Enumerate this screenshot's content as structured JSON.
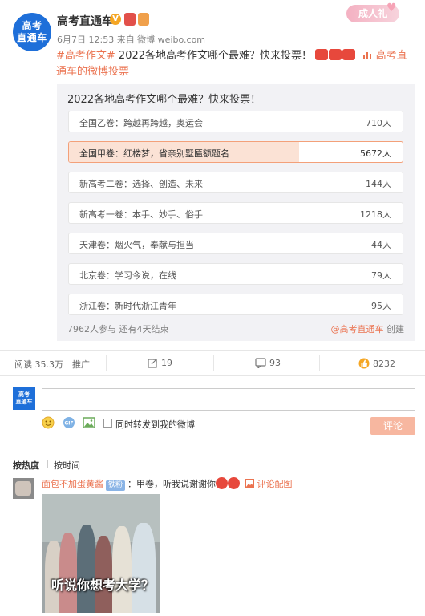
{
  "post": {
    "avatar_text": [
      "高考",
      "直通车"
    ],
    "username": "高考直通车",
    "verified_mark": "V",
    "gift_tag": "成人礼",
    "meta": "6月7日 12:53 来自 微博 weibo.com",
    "hashtag": "#高考作文#",
    "body_text": " 2022各地高考作文哪个最难？快来投票！",
    "source_link": "高考直通车的微博投票"
  },
  "vote": {
    "title": "2022各地高考作文哪个最难？快来投票！",
    "options": [
      {
        "label": "全国乙卷：跨越再跨越，奥运会",
        "count": "710人",
        "share": 0.0
      },
      {
        "label": "全国甲卷：红楼梦，省亲别墅匾额题名",
        "count": "5672人",
        "share": 0.69,
        "selected": true
      },
      {
        "label": "新高考二卷：选择、创造、未来",
        "count": "144人",
        "share": 0.0
      },
      {
        "label": "新高考一卷：本手、妙手、俗手",
        "count": "1218人",
        "share": 0.0
      },
      {
        "label": "天津卷：烟火气，奉献与担当",
        "count": "44人",
        "share": 0.0
      },
      {
        "label": "北京卷：学习今说，在线",
        "count": "79人",
        "share": 0.0
      },
      {
        "label": "浙江卷：新时代浙江青年",
        "count": "95人",
        "share": 0.0
      }
    ],
    "footer_left": "7962人参与 还有4天结束",
    "creator": "@高考直通车",
    "creator_suffix": " 创建"
  },
  "actions": {
    "reads": "阅读 35.3万",
    "promote": "推广",
    "reposts": "19",
    "comments": "93",
    "likes": "8232"
  },
  "comment_input": {
    "avatar_text": [
      "高考",
      "直通车"
    ],
    "value": "",
    "repost_label": "同时转发到我的微博",
    "submit_label": "评论"
  },
  "sort": {
    "hot": "按热度",
    "time": "按时间"
  },
  "comment": {
    "user": "面包不加蛋黄酱",
    "badge": "铁粉",
    "text": "：甲卷，听我说谢谢你",
    "pic_link": "评论配图",
    "image_caption": "听说你想考大学？"
  },
  "colors": {
    "accent": "#eb7350",
    "brand_blue": "#1e6fd9",
    "selected_fill": "#fbe2d5"
  }
}
